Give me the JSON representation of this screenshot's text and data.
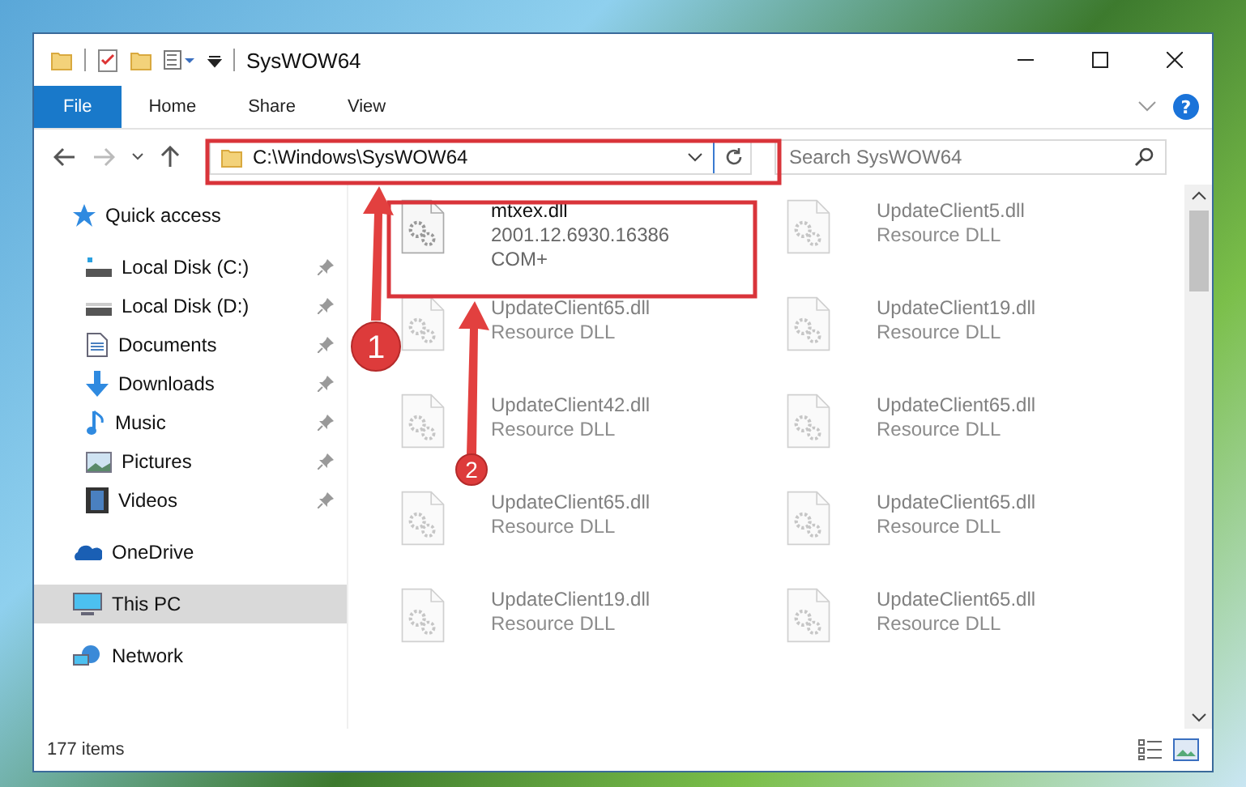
{
  "window": {
    "title": "SysWOW64"
  },
  "ribbon_tabs": [
    {
      "label": "File",
      "selected": true
    },
    {
      "label": "Home",
      "selected": false
    },
    {
      "label": "Share",
      "selected": false
    },
    {
      "label": "View",
      "selected": false
    }
  ],
  "address": {
    "value": "C:\\Windows\\SysWOW64"
  },
  "search": {
    "placeholder": "Search SysWOW64"
  },
  "help": {
    "label": "?"
  },
  "sidebar": {
    "items": [
      {
        "label": "Quick access",
        "kind": "star",
        "selected": false,
        "children": [
          {
            "label": "Local Disk (C:)",
            "kind": "drive-c",
            "pinned": true
          },
          {
            "label": "Local Disk (D:)",
            "kind": "drive",
            "pinned": true
          },
          {
            "label": "Documents",
            "kind": "docs",
            "pinned": true
          },
          {
            "label": "Downloads",
            "kind": "download",
            "pinned": true
          },
          {
            "label": "Music",
            "kind": "music",
            "pinned": true
          },
          {
            "label": "Pictures",
            "kind": "pictures",
            "pinned": true
          },
          {
            "label": "Videos",
            "kind": "videos",
            "pinned": true
          }
        ]
      },
      {
        "label": "OneDrive",
        "kind": "cloud",
        "selected": false
      },
      {
        "label": "This PC",
        "kind": "pc",
        "selected": true
      },
      {
        "label": "Network",
        "kind": "network",
        "selected": false
      }
    ]
  },
  "files": [
    {
      "name": "mtxex.dll",
      "lines": [
        "2001.12.6930.16386",
        "COM+"
      ],
      "blurred": false
    },
    {
      "name": "UpdateClient5.dll",
      "lines": [
        "Resource DLL"
      ],
      "blurred": true
    },
    {
      "name": "UpdateClient65.dll",
      "lines": [
        "Resource DLL"
      ],
      "blurred": true
    },
    {
      "name": "UpdateClient19.dll",
      "lines": [
        "Resource DLL"
      ],
      "blurred": true
    },
    {
      "name": "UpdateClient42.dll",
      "lines": [
        "Resource DLL"
      ],
      "blurred": true
    },
    {
      "name": "UpdateClient65.dll",
      "lines": [
        "Resource DLL"
      ],
      "blurred": true
    },
    {
      "name": "UpdateClient65.dll",
      "lines": [
        "Resource DLL"
      ],
      "blurred": true
    },
    {
      "name": "UpdateClient65.dll",
      "lines": [
        "Resource DLL"
      ],
      "blurred": true
    },
    {
      "name": "UpdateClient19.dll",
      "lines": [
        "Resource DLL"
      ],
      "blurred": true
    },
    {
      "name": "UpdateClient65.dll",
      "lines": [
        "Resource DLL"
      ],
      "blurred": true
    }
  ],
  "status_bar": {
    "count": "177 items"
  },
  "annotations": [
    {
      "label": "1"
    },
    {
      "label": "2"
    }
  ]
}
